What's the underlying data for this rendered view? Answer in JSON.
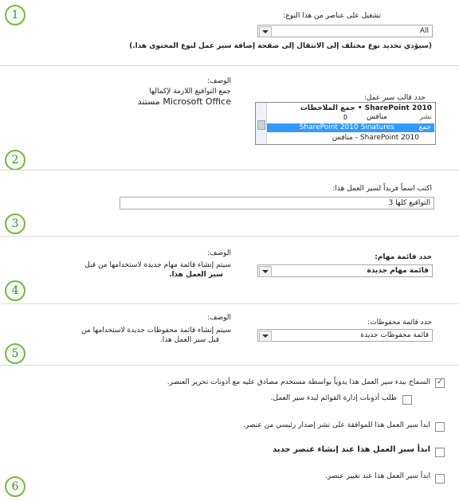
{
  "section1": {
    "label": "تشغيل على عناصر من هذا النوع:",
    "type_value": "All",
    "help": "(سيؤدي تحديد نوع مختلف إلى الانتقال إلى صفحة إضافة سير عمل لنوع المحتوى هذا.)"
  },
  "section2": {
    "template_label": "حدد قالب سير عمل:",
    "desc_heading": "الوصف:",
    "desc_line1": "جمع التواقيع اللازمة لإكمالها",
    "desc_line2": "Microsoft Office مستند",
    "templates": [
      {
        "name": "SharePoint 2010 • جمع الملاحظات",
        "secondary": "نشر"
      },
      {
        "name": "منافس",
        "secondary": ""
      },
      {
        "name": "SharePoint 2010 Sinatures",
        "secondary": "جمع"
      },
      {
        "name": "SharePoint 2010 - منافس",
        "secondary": ""
      }
    ],
    "selected_index": 2
  },
  "section3": {
    "label": "اكتب اسماً فريداً لسير العمل هذا:",
    "name_value": "التواقيع كلها 3"
  },
  "section4": {
    "label": "حدد قائمة مهام:",
    "value": "قائمة مهام جديدة",
    "desc_heading": "الوصف:",
    "desc_line1": "سيتم إنشاء قائمة مهام جديدة لاستخدامها من قبل",
    "desc_line2": "سير العمل هذا."
  },
  "section5": {
    "label": "حدد قائمة محفوظات:",
    "value": "قائمة محفوظات جديدة",
    "desc_heading": "الوصف:",
    "desc_line1": "سيتم إنشاء قائمة محفوظات جديدة لاستخدامها من",
    "desc_line2": "قبل سير العمل هذا."
  },
  "section6": {
    "opt_manual": "السماح ببدء سير العمل هذا يدوياً بواسطة مستخدم مصادق عليه مع أذونات تحرير العنصر.",
    "opt_manage": "طلب أذونات إدارة القوائم لبدء سير العمل.",
    "opt_publish": "ابدأ سير العمل هذا للموافقة على نشر إصدار رئيسي من عنصر.",
    "opt_create": "ابدأ سير العمل هذا عند إنشاء عنصر جديد",
    "opt_change": "ابدأ سير العمل هذا عند تغيير عنصر."
  },
  "badges": [
    "1",
    "2",
    "3",
    "4",
    "5",
    "6"
  ],
  "colors": {
    "accent_green": "#77b84a",
    "selection_blue": "#3399ff"
  }
}
